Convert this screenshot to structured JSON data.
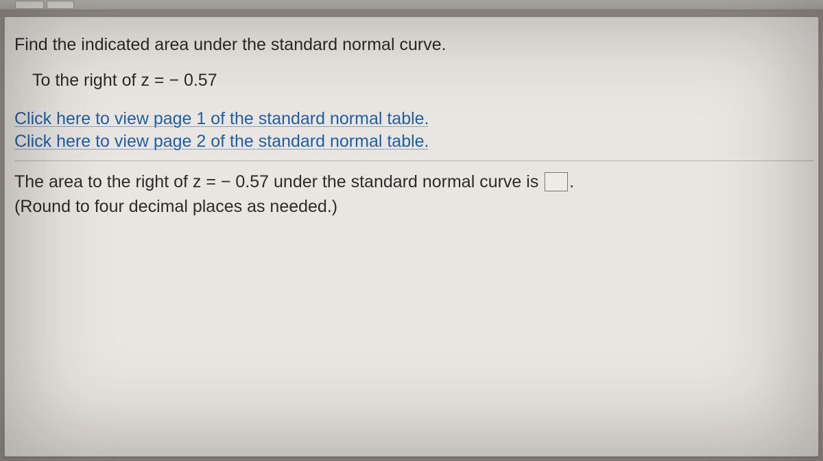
{
  "question": {
    "prompt": "Find the indicated area under the standard normal curve.",
    "sub_prompt": "To the right of z = − 0.57",
    "link1": "Click here to view page 1 of the standard normal table.",
    "link2": "Click here to view page 2 of the standard normal table.",
    "answer_prefix": "The area to the right of z = − 0.57 under the standard normal curve is ",
    "answer_suffix": ".",
    "round_note": "(Round to four decimal places as needed.)",
    "input_value": ""
  }
}
